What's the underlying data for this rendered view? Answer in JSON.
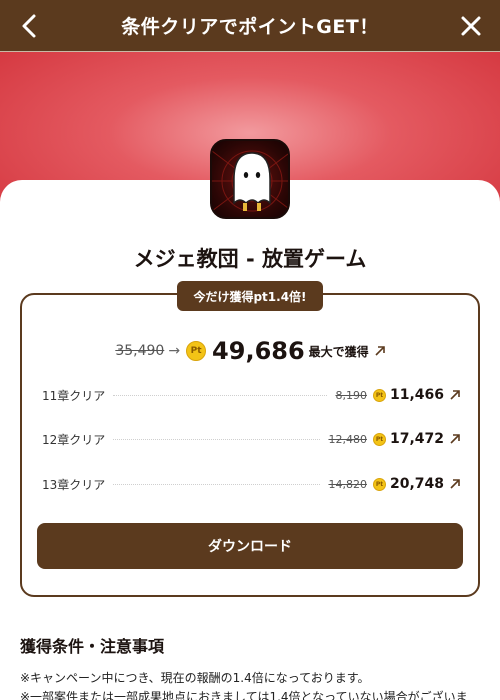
{
  "header": {
    "title": "条件クリアでポイントGET！"
  },
  "app": {
    "name": "メジェ教団 - 放置ゲーム"
  },
  "bonus_tag": "今だけ獲得pt1.4倍!",
  "total": {
    "old": "35,490",
    "arrow": "→",
    "coin": "Pt",
    "new": "49,686",
    "max_label": "最大で獲得"
  },
  "chapters": [
    {
      "label": "11章クリア",
      "old": "8,190",
      "new": "11,466"
    },
    {
      "label": "12章クリア",
      "old": "12,480",
      "new": "17,472"
    },
    {
      "label": "13章クリア",
      "old": "14,820",
      "new": "20,748"
    }
  ],
  "download_label": "ダウンロード",
  "conditions": {
    "title": "獲得条件・注意事項",
    "notes": [
      "※キャンペーン中につき、現在の報酬の1.4倍になっております。",
      "※一部案件または一部成果地点におきましては1.4倍となっていない場合がございま"
    ]
  },
  "colors": {
    "brand": "#5b3a1e",
    "banner": "#d3343c",
    "coin": "#f3c316"
  },
  "icons": [
    "back-chevron-icon",
    "close-x-icon",
    "pt-coin-icon",
    "external-arrow-icon"
  ]
}
